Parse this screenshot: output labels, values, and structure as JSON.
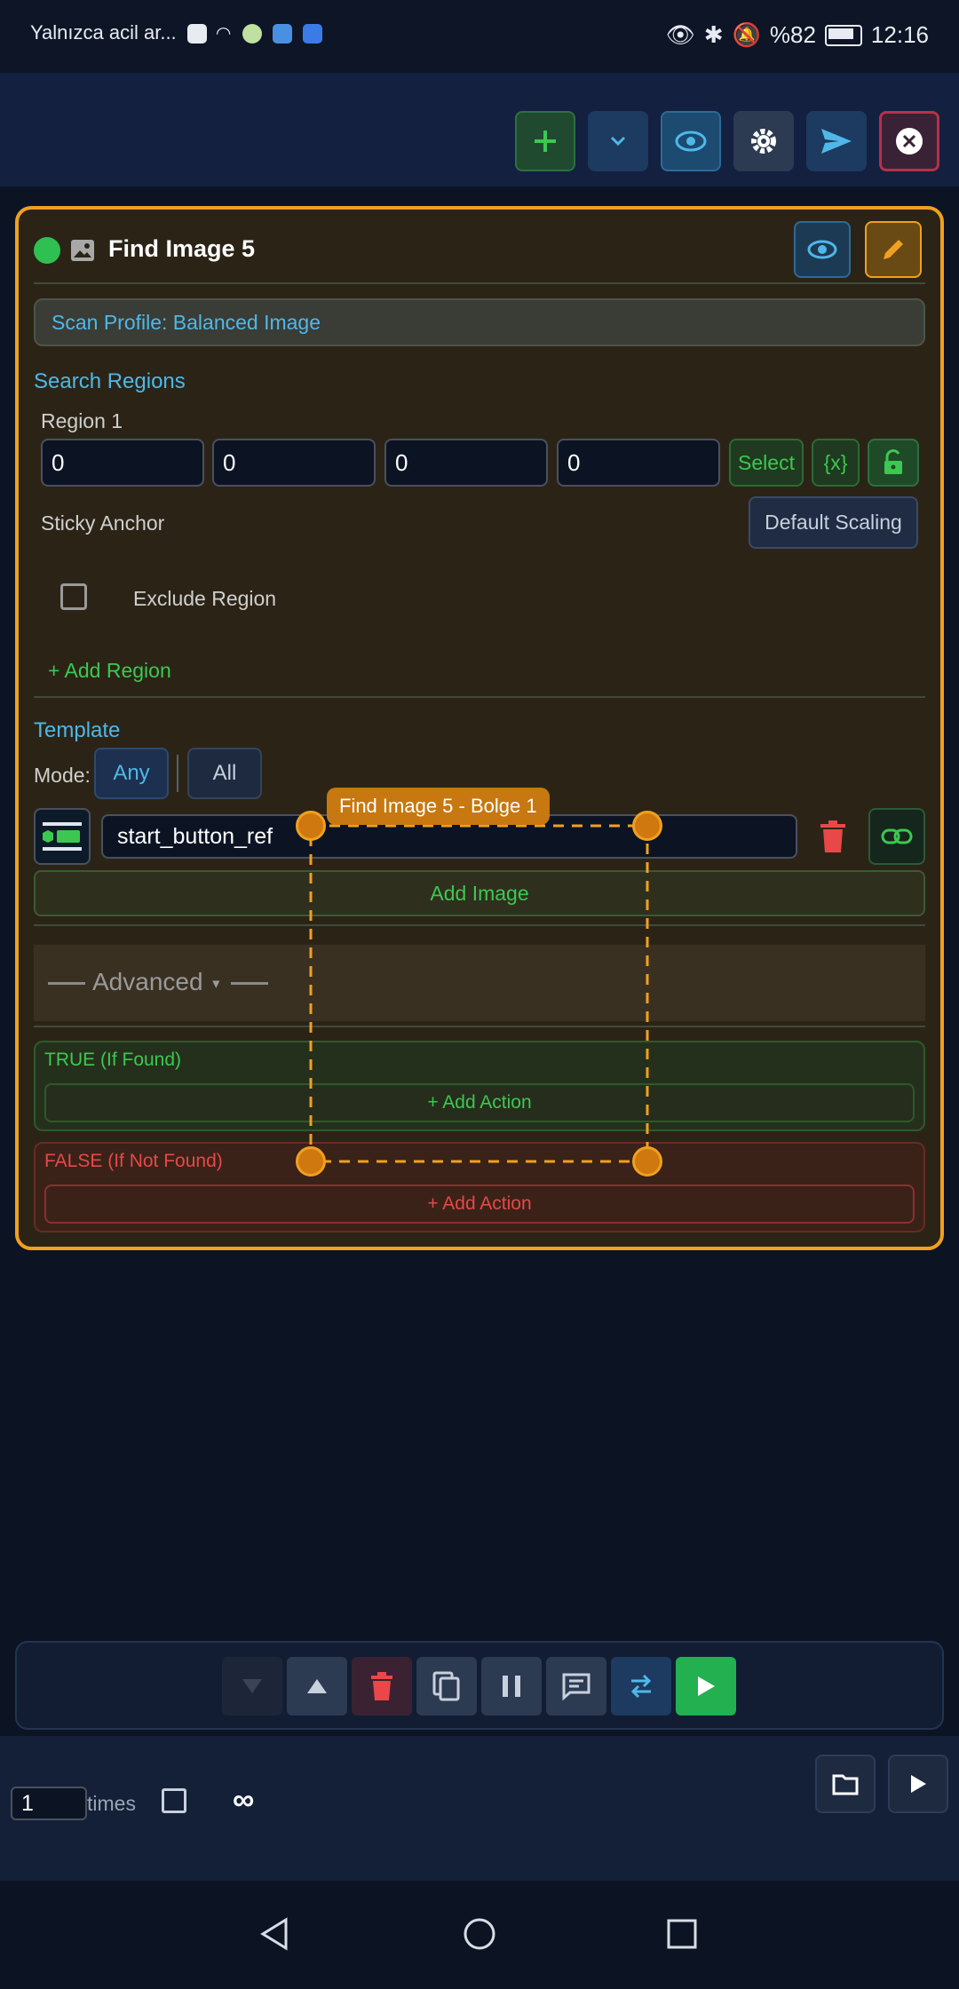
{
  "status_bar": {
    "carrier": "Yalnızca acil ar...",
    "battery": "%82",
    "time": "12:16"
  },
  "card": {
    "title": "Find Image 5",
    "scan_profile": "Scan Profile: Balanced Image",
    "search_regions_label": "Search Regions",
    "region_label": "Region 1",
    "region_values": [
      "0",
      "0",
      "0",
      "0"
    ],
    "select_label": "Select",
    "variable_label": "{x}",
    "sticky_anchor_label": "Sticky Anchor",
    "default_scaling_label": "Default Scaling",
    "exclude_region_label": "Exclude Region",
    "add_region_label": "+ Add Region",
    "template_label": "Template",
    "mode_label": "Mode:",
    "mode_any": "Any",
    "mode_all": "All",
    "image_name": "start_button_ref",
    "add_image_label": "Add Image",
    "advanced_label": "Advanced",
    "true_label": "TRUE (If Found)",
    "true_add_action": "+ Add Action",
    "false_label": "FALSE (If Not Found)",
    "false_add_action": "+ Add Action"
  },
  "overlay": {
    "region_tag": "Find Image 5 - Bolge 1"
  },
  "footer": {
    "repeat_value": "1",
    "times_label": "times",
    "infinity_label": "∞"
  },
  "colors": {
    "accent_orange": "#f0a020",
    "green": "#3cc850",
    "blue": "#4fb8e8",
    "red": "#e84848",
    "background": "#0c1424"
  }
}
